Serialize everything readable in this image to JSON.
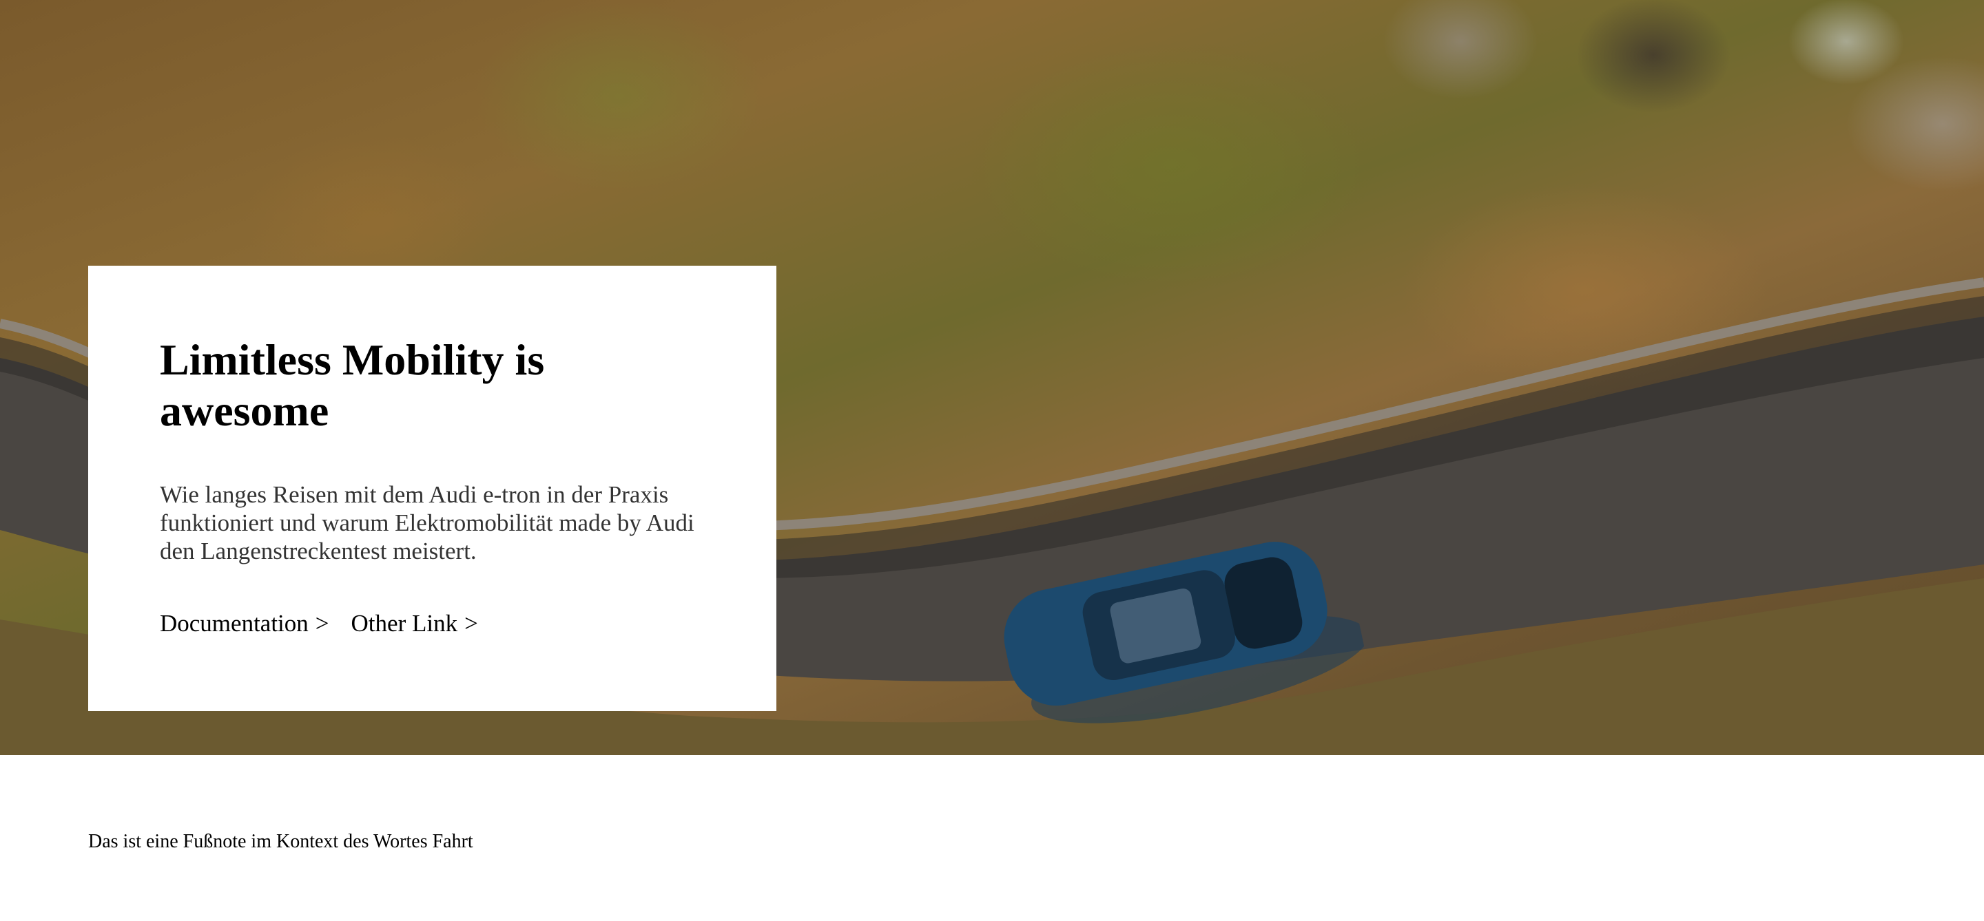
{
  "hero": {
    "image_description_icon": "landscape-photo",
    "colors": {
      "grass": "#7a5a2c",
      "road": "#4a4642",
      "car": "#1c4a6e",
      "card_background": "#ffffff"
    }
  },
  "card": {
    "title": "Limitless Mobility is awesome",
    "text": "Wie langes Reisen mit dem Audi e-tron in der Praxis funktioniert und warum Elektromobilität made by Audi den Langenstreckentest meistert.",
    "links": [
      {
        "label": "Documentation",
        "icon": "chevron-right-icon",
        "chevron": ">"
      },
      {
        "label": "Other Link",
        "icon": "chevron-right-icon",
        "chevron": ">"
      }
    ]
  },
  "footnote": {
    "text": "Das ist eine Fußnote im Kontext des Wortes Fahrt"
  }
}
